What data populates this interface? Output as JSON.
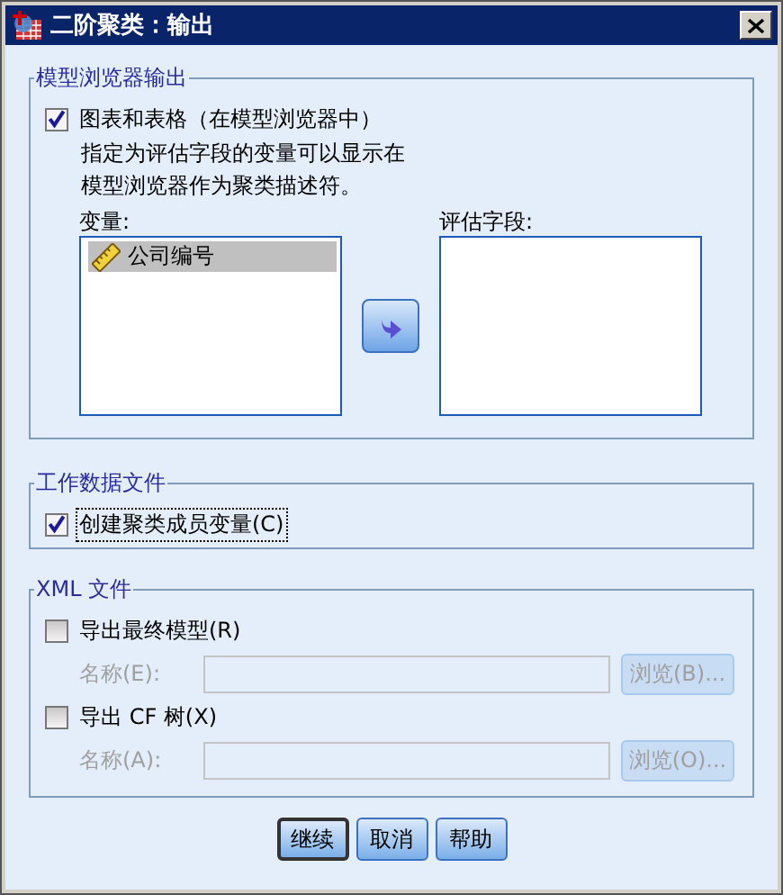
{
  "window": {
    "title": "二阶聚类：输出"
  },
  "model_browser_output": {
    "title": "模型浏览器输出",
    "checkbox": {
      "label": "图表和表格（在模型浏览器中）",
      "checked": true
    },
    "note": "指定为评估字段的变量可以显示在模型浏览器作为聚类描述符。",
    "variables_label": "变量:",
    "variables": [
      {
        "name": "公司编号",
        "selected": true
      }
    ],
    "evaluation_label": "评估字段:"
  },
  "working_data_file": {
    "title": "工作数据文件",
    "checkbox": {
      "label": "创建聚类成员变量(C)",
      "checked": true,
      "focused": true
    }
  },
  "xml_files": {
    "title": "XML 文件",
    "exports": [
      {
        "label": "导出最终模型(R)",
        "checked": false,
        "name_label": "名称(E):",
        "disabled": true,
        "browse": "浏览(B)..."
      },
      {
        "label": "导出 CF 树(X)",
        "checked": false,
        "name_label": "名称(A):",
        "disabled": true,
        "browse": "浏览(O)..."
      }
    ]
  },
  "buttons": [
    {
      "label": "继续",
      "default": true
    },
    {
      "label": "取消",
      "default": false
    },
    {
      "label": "帮助",
      "default": false
    }
  ]
}
